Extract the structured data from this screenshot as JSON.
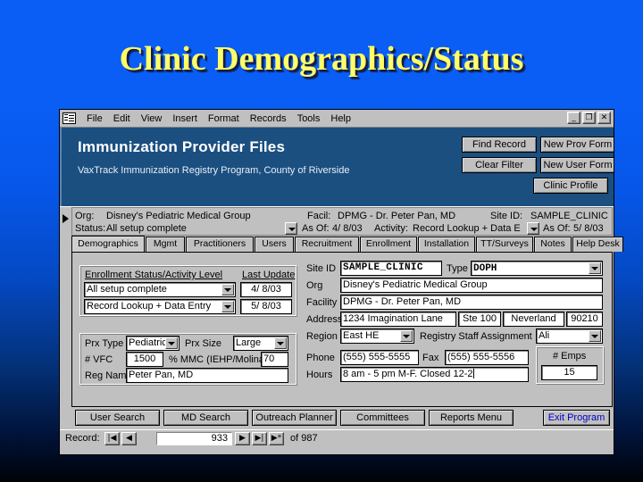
{
  "slide": {
    "title": "Clinic Demographics/Status"
  },
  "window": {
    "menu": [
      "File",
      "Edit",
      "View",
      "Insert",
      "Format",
      "Records",
      "Tools",
      "Help"
    ],
    "controls": {
      "minimize": "_",
      "restore": "❐",
      "close": "✕"
    },
    "app_icon": "access-form-icon"
  },
  "banner": {
    "title": "Immunization Provider Files",
    "subtitle": "VaxTrack Immunization Registry Program, County of Riverside",
    "buttons": {
      "find_record": "Find Record",
      "new_prov_form": "New Prov Form",
      "clear_filter": "Clear Filter",
      "new_user_form": "New User Form",
      "clinic_profile": "Clinic Profile"
    }
  },
  "strip": {
    "org_label": "Org:",
    "org_value": "Disney's Pediatric Medical Group",
    "status_label": "Status:",
    "status_value": "All setup complete",
    "facil_label": "Facil:",
    "facil_value": "DPMG - Dr. Peter Pan, MD",
    "siteid_label": "Site ID:",
    "siteid_value": "SAMPLE_CLINIC",
    "asof1_label": "As Of:",
    "asof1_value": "4/ 8/03",
    "activity_label": "Activity:",
    "activity_value": "Record Lookup + Data E",
    "asof2_label": "As Of:",
    "asof2_value": "5/ 8/03"
  },
  "tabs": [
    {
      "label": "Demographics",
      "active": true
    },
    {
      "label": "Mgmt",
      "active": false
    },
    {
      "label": "Practitioners",
      "active": false
    },
    {
      "label": "Users",
      "active": false
    },
    {
      "label": "Recruitment",
      "active": false
    },
    {
      "label": "Enrollment",
      "active": false
    },
    {
      "label": "Installation",
      "active": false
    },
    {
      "label": "TT/Surveys",
      "active": false
    },
    {
      "label": "Notes",
      "active": false
    },
    {
      "label": "Help Desk",
      "active": false
    }
  ],
  "left_panel": {
    "enrollment_header": "Enrollment Status/Activity Level",
    "last_update_header": "Last Update",
    "status_value": "All setup complete",
    "status_date": "4/ 8/03",
    "activity_value": "Record Lookup + Data Entry",
    "activity_date": "5/ 8/03",
    "prx_type_label": "Prx Type",
    "prx_type_value": "Pediatric",
    "prx_size_label": "Prx Size",
    "prx_size_value": "Large",
    "vfc_label": "# VFC",
    "vfc_value": "1500",
    "mmc_label": "% MMC (IEHP/Molina)",
    "mmc_value": "70",
    "reg_name_label": "Reg Name",
    "reg_name_value": "Peter Pan, MD"
  },
  "right_panel": {
    "siteid_label": "Site ID",
    "siteid_value": "SAMPLE_CLINIC",
    "type_label": "Type",
    "type_value": "DOPH",
    "org_label": "Org",
    "org_value": "Disney's Pediatric Medical Group",
    "facility_label": "Facility",
    "facility_value": "DPMG - Dr. Peter Pan, MD",
    "address_label": "Address",
    "address_value": "1234 Imagination Lane",
    "suite_value": "Ste 100",
    "city_value": "Neverland",
    "zip_value": "90210",
    "region_label": "Region",
    "region_value": "East HE",
    "staff_label": "Registry Staff Assignment",
    "staff_value": "Ali",
    "phone_label": "Phone",
    "phone_value": "(555) 555-5555",
    "fax_label": "Fax",
    "fax_value": "(555) 555-5556",
    "hours_label": "Hours",
    "hours_value": "8 am - 5 pm M-F.  Closed 12-2",
    "emps_label": "# Emps",
    "emps_value": "15"
  },
  "bottom_buttons": {
    "user_search": "User Search",
    "md_search": "MD Search",
    "outreach_planner": "Outreach Planner",
    "committees": "Committees",
    "reports_menu": "Reports Menu",
    "exit_program": "Exit Program"
  },
  "navigator": {
    "label": "Record:",
    "first": "|◀",
    "prev": "◀",
    "current": "933",
    "next": "▶",
    "last": "▶|",
    "new": "▶*",
    "of_label": "of",
    "total": "987"
  },
  "colors": {
    "slide_title": "#ffff66",
    "banner_bg": "#1b4f80",
    "window_bg": "#c0c0c0",
    "exit_link": "#0000cc"
  }
}
